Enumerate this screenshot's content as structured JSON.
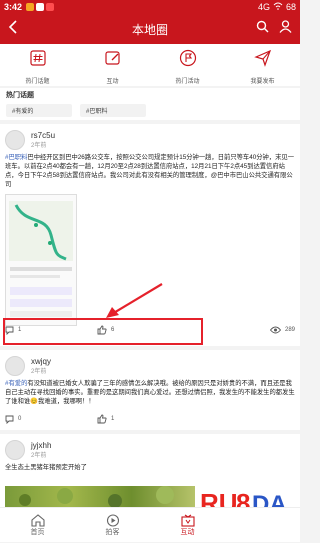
{
  "status_bar": {
    "time": "3:42",
    "signal": "4G",
    "battery": "68"
  },
  "header": {
    "title": "本地圈",
    "back_icon": "back-arrow-icon",
    "search_icon": "search-icon",
    "user_icon": "user-icon"
  },
  "quick_actions": [
    {
      "label": "热门话题",
      "icon": "hashtag-icon"
    },
    {
      "label": "互动",
      "icon": "edit-icon"
    },
    {
      "label": "热门活动",
      "icon": "flag-icon"
    },
    {
      "label": "我要发布",
      "icon": "send-icon"
    }
  ],
  "hot_topics": {
    "title": "热门话题",
    "items": [
      "#有爱的",
      "#巴职料"
    ]
  },
  "posts": [
    {
      "username": "rs7c5u",
      "time": "2年前",
      "tag": "#巴职料",
      "text": "巴中经开区到巴中26路公交车，按照公交公司规定预计15分钟一趟，日前只等车40分钟，末见一班车。以前在2点40都会有一趟，12月20至2点28到达置信府站点，12月21日下午2点45到达置信府站点，今日下午2点58到达置信府站点。我公司对此有没有相关的管理制度，@巴中市巴山公共交通有限公司",
      "comments": "1",
      "likes": "6",
      "views": "289"
    },
    {
      "username": "xwjqy",
      "time": "2年前",
      "tag": "#有爱的",
      "text": "有没知道被已婚女人欺骗了三年的感情怎么解决哦。被给的原因只是对娇贵的不满，而且还是我自己主动在寻找回婚的事实。重要的是这期间我们真心爱过。还想过情侣照，我发生的不能发生的都发生了谁和谁😊我难道，我哪啊！！",
      "comments": "0",
      "likes": "1",
      "views": ""
    },
    {
      "username": "jyjxhh",
      "time": "2年前",
      "tag": "",
      "text": "全生态土黑猪年猪预定开始了",
      "comments": "",
      "likes": "",
      "views": ""
    }
  ],
  "bottom_nav": [
    {
      "label": "首页",
      "icon": "home-icon"
    },
    {
      "label": "拍客",
      "icon": "video-icon"
    },
    {
      "label": "互动",
      "icon": "interact-icon"
    },
    {
      "label": "",
      "icon": ""
    }
  ],
  "colors": {
    "brand": "#c8161d",
    "link": "#3a62b8",
    "highlight": "#e5212b"
  }
}
